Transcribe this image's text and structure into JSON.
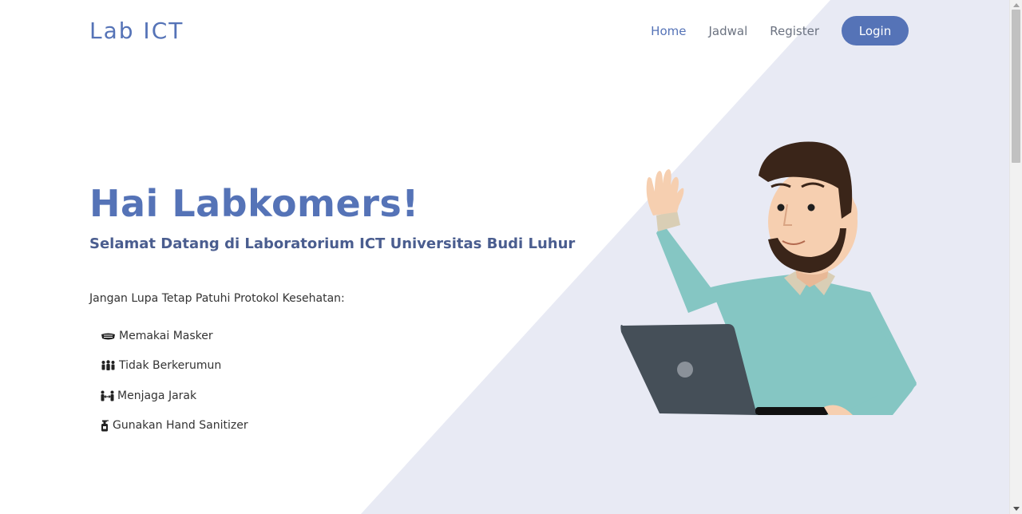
{
  "brand": {
    "name": "Lab ICT"
  },
  "nav": {
    "items": [
      {
        "label": "Home",
        "active": true
      },
      {
        "label": "Jadwal",
        "active": false
      },
      {
        "label": "Register",
        "active": false
      }
    ],
    "login_label": "Login"
  },
  "hero": {
    "title": "Hai Labkomers!",
    "subtitle": "Selamat Datang di Laboratorium ICT Universitas Budi Luhur",
    "protocol_heading": "Jangan Lupa Tetap Patuhi Protokol Kesehatan:",
    "protocols": [
      {
        "icon": "mask-icon",
        "label": "Memakai Masker"
      },
      {
        "icon": "crowd-icon",
        "label": "Tidak Berkerumun"
      },
      {
        "icon": "distance-icon",
        "label": "Menjaga Jarak"
      },
      {
        "icon": "hand-sanitizer-icon",
        "label": "Gunakan Hand Sanitizer"
      }
    ]
  },
  "colors": {
    "accent": "#5573b7",
    "subtitle": "#4a5d8f",
    "background_shape": "#e8eaf4",
    "shirt": "#85c6c3",
    "laptop": "#454f58",
    "hair": "#3a2519",
    "skin": "#f6cfb0"
  }
}
